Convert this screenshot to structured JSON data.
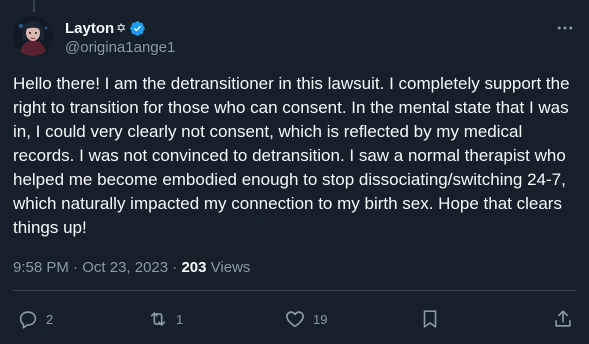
{
  "tweet": {
    "author": {
      "display_name": "Layton",
      "handle": "@origina1ange1",
      "name_emoji": "✡",
      "verified": true,
      "avatar": "profile-photo"
    },
    "text": "Hello there! I am the detransitioner in this lawsuit. I completely support the right to transition for those who can consent. In the mental state that I was in, I could very clearly not consent, which is reflected by my medical records. I was not convinced to detransition. I saw a normal therapist who helped me become embodied enough to stop dissociating/switching 24-7, which naturally impacted my connection to my birth sex. Hope that clears things up!",
    "time": "9:58 PM",
    "separator": "·",
    "date": "Oct 23, 2023",
    "views_count": "203",
    "views_label": "Views"
  },
  "actions": {
    "reply": {
      "icon": "reply-icon",
      "count": "2"
    },
    "retweet": {
      "icon": "retweet-icon",
      "count": "1"
    },
    "like": {
      "icon": "heart-icon",
      "count": "19"
    },
    "bookmark": {
      "icon": "bookmark-icon"
    },
    "share": {
      "icon": "share-icon"
    }
  },
  "colors": {
    "background": "#15202b",
    "text": "#f7f9f9",
    "secondary_text": "#8b98a5",
    "divider": "#38444d",
    "verified": "#1d9bf0"
  }
}
